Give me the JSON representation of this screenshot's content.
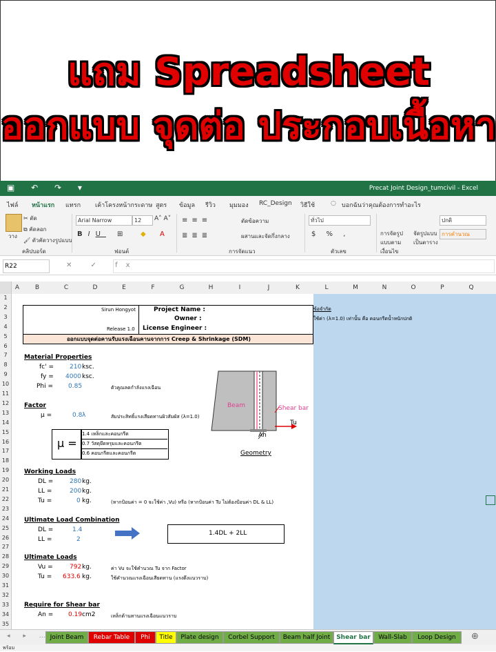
{
  "banner": {
    "line1": "แถม Spreadsheet",
    "line2": "ออกแบบ จุดต่อ ประกอบเนื้อหา"
  },
  "window": {
    "title": "Precat Joint Design_tumcivil  -  Excel"
  },
  "ribbon_tabs": [
    "ไฟล์",
    "หน้าแรก",
    "แทรก",
    "เค้าโครงหน้ากระดาษ",
    "สูตร",
    "ข้อมูล",
    "รีวิว",
    "มุมมอง",
    "RC_Design",
    "วิธีใช้"
  ],
  "tell_me": "บอกฉันว่าคุณต้องการทำอะไร",
  "ribbon": {
    "paste": "วาง",
    "cut": "ตัด",
    "copy": "คัดลอก",
    "format_painter": "ตัวคัดวางรูปแบบ",
    "clipboard": "คลิปบอร์ด",
    "font_name": "Arial Narrow",
    "font_size": "12",
    "font_group": "ฟอนต์",
    "wrap": "ตัดข้อความ",
    "merge": "ผสานและจัดกึ่งกลาง",
    "align_group": "การจัดแนว",
    "number_format": "ทั่วไป",
    "number_group": "ตัวเลข",
    "cond_format": "การจัดรูปแบบตามเงื่อนไข",
    "format_table": "จัดรูปแบบเป็นตาราง",
    "style_normal": "ปกติ",
    "style_calc": "การคำนวณ"
  },
  "formula": {
    "name_box": "R22"
  },
  "columns": [
    "A",
    "B",
    "C",
    "D",
    "E",
    "F",
    "G",
    "H",
    "I",
    "J",
    "K",
    "L",
    "M",
    "N",
    "O",
    "P",
    "Q"
  ],
  "rows": [
    "1",
    "2",
    "3",
    "4",
    "5",
    "6",
    "7",
    "8",
    "9",
    "10",
    "11",
    "12",
    "13",
    "14",
    "15",
    "16",
    "17",
    "18",
    "19",
    "20",
    "21",
    "22",
    "23",
    "24",
    "25",
    "26",
    "27",
    "28",
    "29",
    "30",
    "31",
    "32",
    "33",
    "34",
    "35"
  ],
  "sheet": {
    "author": "Sirun Hongyot",
    "release": "Release 1.0",
    "project_name": "Project Name :",
    "owner": "Owner :",
    "license": "License Engineer :",
    "title": "ออกแบบจุดต่อคานรับแรงเฉือนคานจากการ Creep & Shrinkage (SDM)",
    "note_title": "ข้อจำกัด",
    "note_text": "ใช้ค่า (λ=1.0) เท่านั้น คือ คอนกรีตน้ำหนักปกติ",
    "material": {
      "header": "Material Properties",
      "fc_label": "fc' =",
      "fc": "210",
      "fc_unit": "ksc.",
      "fy_label": "fy =",
      "fy": "4000",
      "fy_unit": "ksc.",
      "phi_label": "Phi =",
      "phi": "0.85",
      "phi_note": "ตัวคูณลดกำลังแรงเฉือน"
    },
    "factor": {
      "header": "Factor",
      "mu_label": "μ =",
      "mu": "0.8",
      "mu_unit": "λ",
      "mu_note": "สัมประสิทธิ์แรงเสียดทานผิวสัมผัส (λ=1.0)",
      "table_mu": "μ =",
      "t1": "1.4 เหล็กและคอนกรีต",
      "t2": "0.7 วัสดุยึดหรุมและคอนกรีต",
      "t3": "0.6 คอนกรีตและคอนกรีต"
    },
    "diagram": {
      "beam": "Beam",
      "shear_bar": "Shear bar",
      "tu": "Tu",
      "an": "An",
      "geometry": "Geometry"
    },
    "working": {
      "header": "Working Loads",
      "dl_label": "DL =",
      "dl": "280",
      "ll_label": "LL =",
      "ll": "200",
      "tu_label": "Tu =",
      "tu": "0",
      "unit": "kg.",
      "tu_note": "(หากป้อนค่า = 0 จะใช้ค่า ,Vu) หรือ (หากป้อนค่า Tu ไม่ต้องป้อนค่า DL & LL)"
    },
    "ultimate_comb": {
      "header": "Ultimate Load Combination",
      "dl_label": "DL =",
      "dl": "1.4",
      "ll_label": "LL =",
      "ll": "2",
      "formula": "1.4DL + 2LL"
    },
    "ultimate": {
      "header": "Ultimate Loads",
      "vu_label": "Vu =",
      "vu": "792",
      "tu_label": "Tu =",
      "tu": "633.6",
      "unit": "kg.",
      "vu_note": "ค่า Vu จะใช้คำนวณ Tu จาก Factor",
      "tu_note": "ใช้คำนวณแรงเฉือนเสียดทาน (แรงดึงแนวราบ)"
    },
    "shear": {
      "header": "Require for Shear bar",
      "an_label": "An =",
      "an": "0.19",
      "an_unit": "cm2",
      "an_note": "เหล็กต้านทานแรงเฉือนแนวราบ"
    }
  },
  "sheet_tabs": [
    {
      "name": "Joint Beam",
      "color": "#70ad47"
    },
    {
      "name": "Rebar Table",
      "color": "#e00000"
    },
    {
      "name": "Phi",
      "color": "#e00000"
    },
    {
      "name": "Title",
      "color": "#ffff00"
    },
    {
      "name": "Plate design",
      "color": "#70ad47"
    },
    {
      "name": "Corbel Support",
      "color": "#70ad47"
    },
    {
      "name": "Beam half Joint",
      "color": "#70ad47"
    },
    {
      "name": "Shear bar",
      "color": "#ffffff"
    },
    {
      "name": "Wall-Slab",
      "color": "#70ad47"
    },
    {
      "name": "Loop Design",
      "color": "#70ad47"
    }
  ],
  "status": "พร้อม"
}
